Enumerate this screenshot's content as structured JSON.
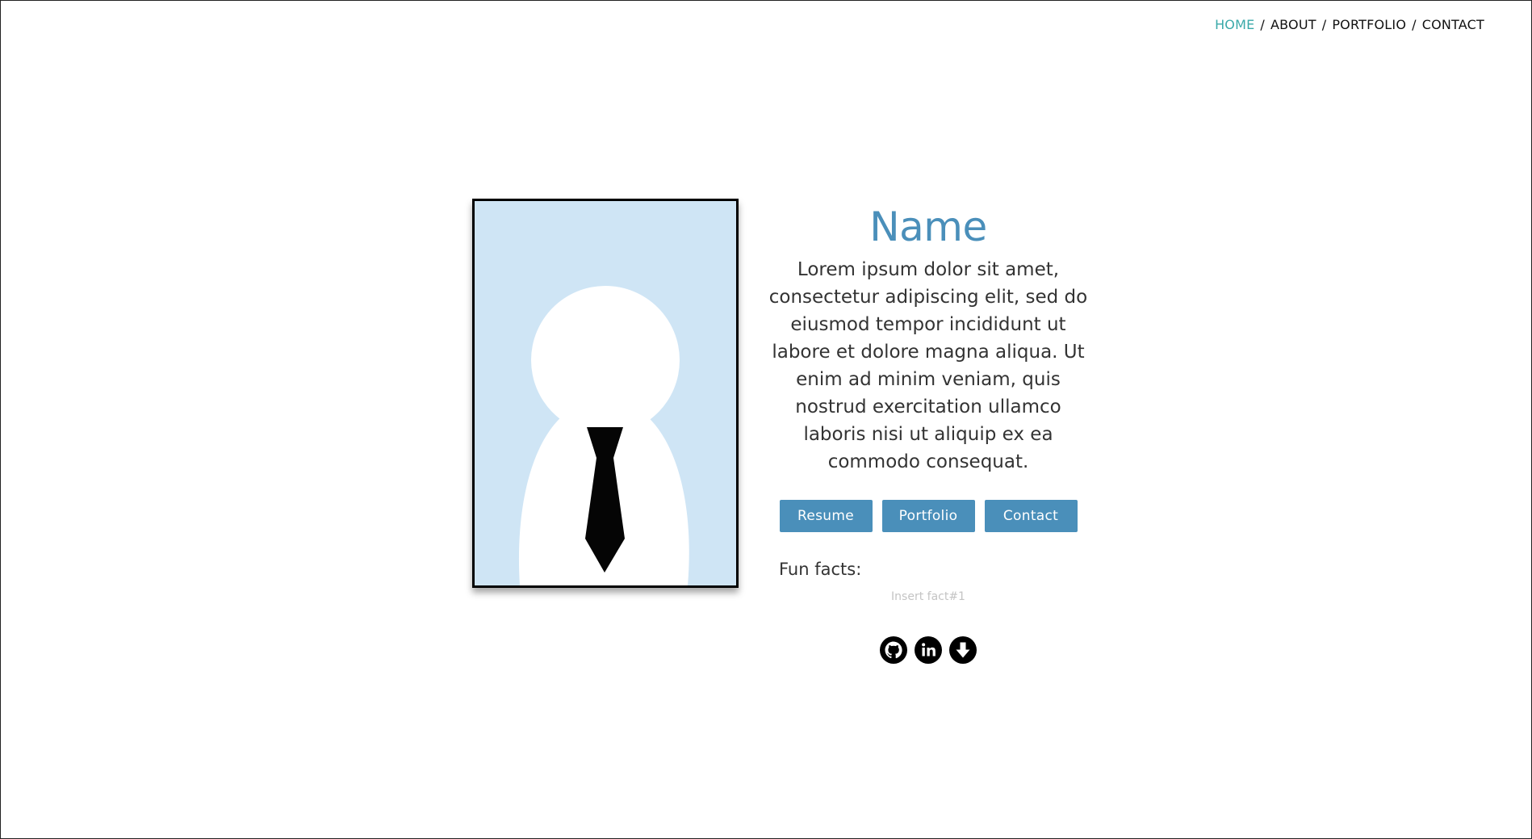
{
  "nav": {
    "items": [
      {
        "label": "HOME",
        "active": true
      },
      {
        "label": "ABOUT",
        "active": false
      },
      {
        "label": "PORTFOLIO",
        "active": false
      },
      {
        "label": "CONTACT",
        "active": false
      }
    ],
    "separator": "/",
    "active_color": "#3aa9a9"
  },
  "profile": {
    "name": "Name",
    "bio": "Lorem ipsum dolor sit amet, consectetur adipiscing elit, sed do eiusmod tempor incididunt ut labore et dolore magna aliqua. Ut enim ad minim veniam, quis nostrud exercitation ullamco laboris nisi ut aliquip ex ea commodo consequat.",
    "portrait_bg_color": "#cfe5f5"
  },
  "buttons": {
    "resume": "Resume",
    "portfolio": "Portfolio",
    "contact": "Contact",
    "color": "#4a8fba"
  },
  "fun_facts": {
    "title": "Fun facts:",
    "facts": [
      "Insert fact#1"
    ]
  },
  "social": {
    "icons": [
      "github-icon",
      "linkedin-icon",
      "download-icon"
    ]
  }
}
